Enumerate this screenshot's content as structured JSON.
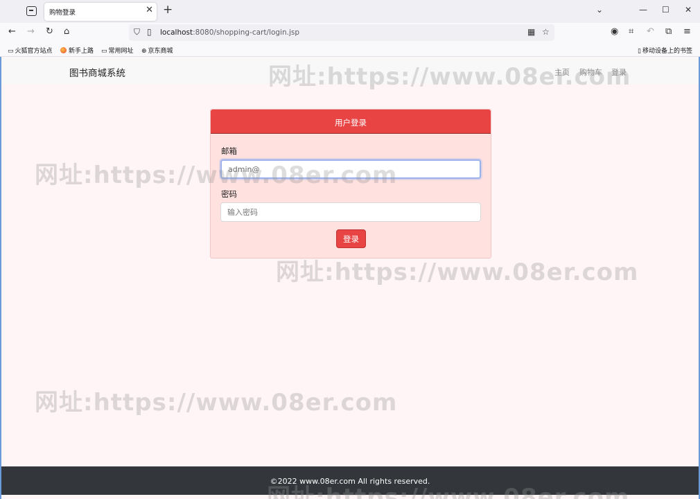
{
  "browser": {
    "tab_title": "购物登录",
    "close_glyph": "✕",
    "new_tab_glyph": "+",
    "url_host": "localhost",
    "url_path": ":8080/shopping-cart/login.jsp"
  },
  "bookmarks": {
    "items": [
      "火狐官方站点",
      "新手上路",
      "常用网址",
      "京东商城"
    ],
    "mobile": "移动设备上的书签"
  },
  "site": {
    "brand": "图书商城系统",
    "nav": [
      "主页",
      "购物车",
      "登录"
    ]
  },
  "login": {
    "title": "用户登录",
    "email_label": "邮箱",
    "email_value": "admin@",
    "password_label": "密码",
    "password_placeholder": "输入密码",
    "submit_label": "登录"
  },
  "footer": {
    "text": "©2022 www.08er.com All rights reserved."
  },
  "watermark": {
    "text": "网址:https://www.08er.com"
  },
  "colors": {
    "accent": "#e84444",
    "card_bg": "#ffe1df",
    "page_bg": "#fff5f6",
    "footer_bg": "#33373c"
  }
}
